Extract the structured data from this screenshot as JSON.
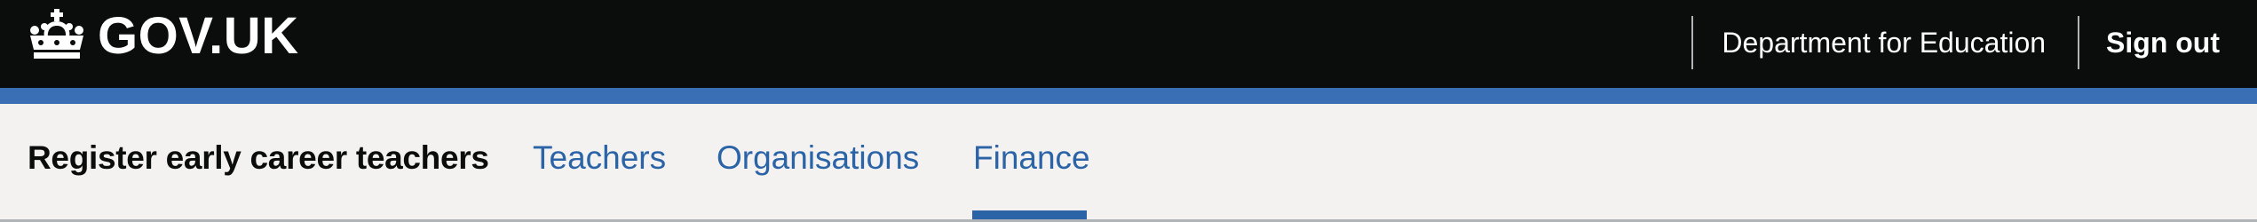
{
  "header": {
    "logo_text": "GOV.UK",
    "organisation": "Department for Education",
    "sign_out": "Sign out",
    "background": "#0b0c0c",
    "accent_bar": "#3a6fb5"
  },
  "service": {
    "name": "Register early career teachers"
  },
  "tabs": [
    {
      "label": "Teachers",
      "active": false
    },
    {
      "label": "Organisations",
      "active": false
    },
    {
      "label": "Finance",
      "active": true
    }
  ],
  "colors": {
    "link": "#2b63a7",
    "nav_background": "#f3f2f1",
    "text": "#0b0c0c"
  }
}
